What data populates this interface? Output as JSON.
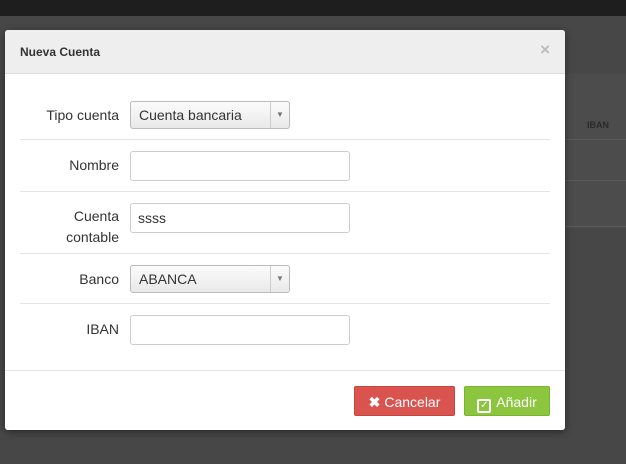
{
  "background": {
    "iban_column_header": "IBAN"
  },
  "modal": {
    "title": "Nueva Cuenta",
    "close_glyph": "×",
    "fields": {
      "tipo_cuenta": {
        "label": "Tipo cuenta",
        "value": "Cuenta bancaria"
      },
      "nombre": {
        "label": "Nombre",
        "value": ""
      },
      "cuenta_contable": {
        "label_line1": "Cuenta",
        "label_line2": "contable",
        "value": "ssss"
      },
      "banco": {
        "label": "Banco",
        "value": "ABANCA"
      },
      "iban": {
        "label": "IBAN",
        "value": ""
      }
    },
    "buttons": {
      "cancel": {
        "icon": "x-mark-icon",
        "glyph": "✖",
        "label": "Cancelar",
        "color": "#d9534f"
      },
      "add": {
        "icon": "check-square-icon",
        "glyph": "✓",
        "label": "Añadir",
        "color": "#8cc63f"
      }
    },
    "select_arrow_glyph": "▼"
  }
}
